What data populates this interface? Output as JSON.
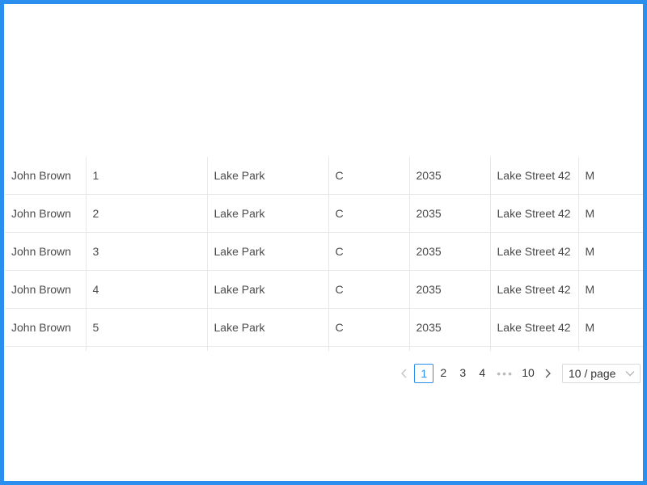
{
  "table": {
    "rows": [
      {
        "name": "John Brown",
        "num": "1",
        "place": "Lake Park",
        "letter": "C",
        "year": "2035",
        "street": "Lake Street 42",
        "gender": "M"
      },
      {
        "name": "John Brown",
        "num": "2",
        "place": "Lake Park",
        "letter": "C",
        "year": "2035",
        "street": "Lake Street 42",
        "gender": "M"
      },
      {
        "name": "John Brown",
        "num": "3",
        "place": "Lake Park",
        "letter": "C",
        "year": "2035",
        "street": "Lake Street 42",
        "gender": "M"
      },
      {
        "name": "John Brown",
        "num": "4",
        "place": "Lake Park",
        "letter": "C",
        "year": "2035",
        "street": "Lake Street 42",
        "gender": "M"
      },
      {
        "name": "John Brown",
        "num": "5",
        "place": "Lake Park",
        "letter": "C",
        "year": "2035",
        "street": "Lake Street 42",
        "gender": "M"
      }
    ]
  },
  "pagination": {
    "pages": [
      "1",
      "2",
      "3",
      "4"
    ],
    "ellipsis": "•••",
    "last_page": "10",
    "current": "1",
    "page_size": "10 / page"
  },
  "colors": {
    "accent": "#2b8ff0",
    "border": "#e8e8e8"
  },
  "icons": {
    "prev": "chevron-left-icon",
    "next": "chevron-right-icon",
    "dropdown": "chevron-down-icon"
  }
}
